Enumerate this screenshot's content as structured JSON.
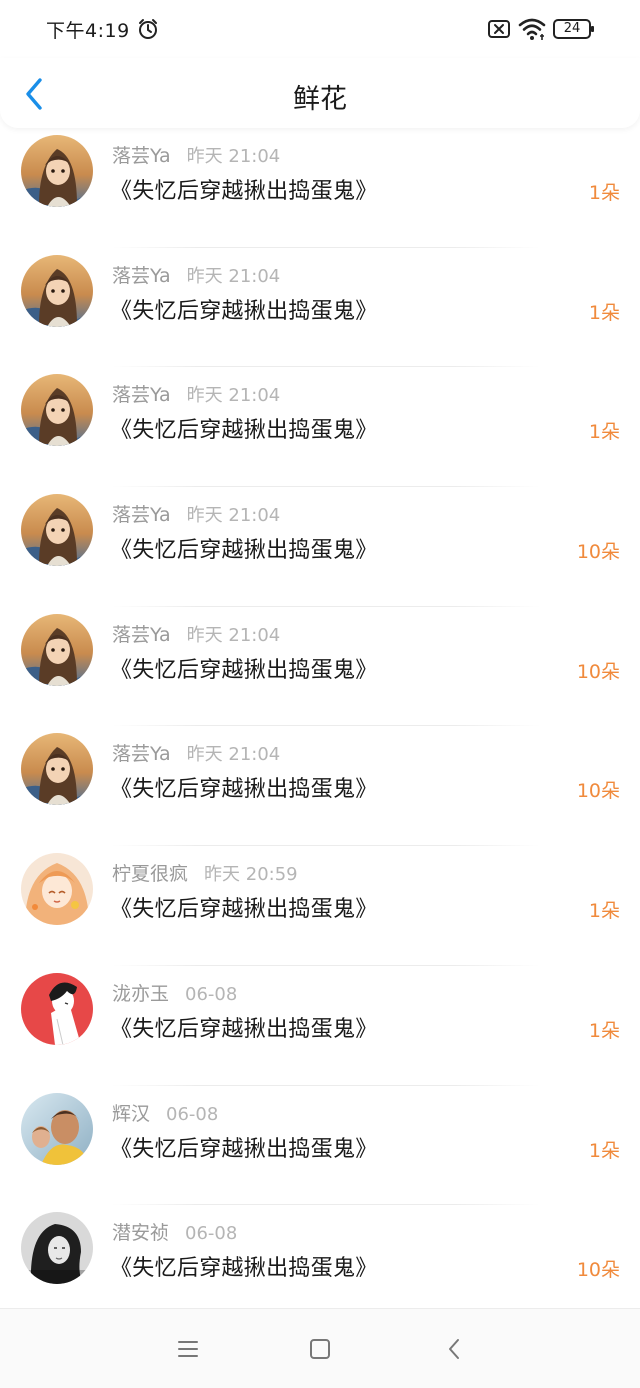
{
  "status": {
    "time": "下午4:19",
    "battery": "24"
  },
  "header": {
    "title": "鲜花"
  },
  "colors": {
    "accent": "#1a8ee8",
    "count": "#f08a3c"
  },
  "items": [
    {
      "user": "落芸Ya",
      "time": "昨天 21:04",
      "title": "《失忆后穿越揪出捣蛋鬼》",
      "count": "1朵",
      "avatar": "anime-girl-sunset"
    },
    {
      "user": "落芸Ya",
      "time": "昨天 21:04",
      "title": "《失忆后穿越揪出捣蛋鬼》",
      "count": "1朵",
      "avatar": "anime-girl-sunset"
    },
    {
      "user": "落芸Ya",
      "time": "昨天 21:04",
      "title": "《失忆后穿越揪出捣蛋鬼》",
      "count": "1朵",
      "avatar": "anime-girl-sunset"
    },
    {
      "user": "落芸Ya",
      "time": "昨天 21:04",
      "title": "《失忆后穿越揪出捣蛋鬼》",
      "count": "10朵",
      "avatar": "anime-girl-sunset"
    },
    {
      "user": "落芸Ya",
      "time": "昨天 21:04",
      "title": "《失忆后穿越揪出捣蛋鬼》",
      "count": "10朵",
      "avatar": "anime-girl-sunset"
    },
    {
      "user": "落芸Ya",
      "time": "昨天 21:04",
      "title": "《失忆后穿越揪出捣蛋鬼》",
      "count": "10朵",
      "avatar": "anime-girl-sunset"
    },
    {
      "user": "柠夏很疯",
      "time": "昨天 20:59",
      "title": "《失忆后穿越揪出捣蛋鬼》",
      "count": "1朵",
      "avatar": "anime-girl-orange"
    },
    {
      "user": "泷亦玉",
      "time": "06-08",
      "title": "《失忆后穿越揪出捣蛋鬼》",
      "count": "1朵",
      "avatar": "anime-boy-red"
    },
    {
      "user": "辉汉",
      "time": "06-08",
      "title": "《失忆后穿越揪出捣蛋鬼》",
      "count": "1朵",
      "avatar": "photo-man"
    },
    {
      "user": "潜安祯",
      "time": "06-08",
      "title": "《失忆后穿越揪出捣蛋鬼》",
      "count": "10朵",
      "avatar": "photo-woman-bw"
    }
  ]
}
